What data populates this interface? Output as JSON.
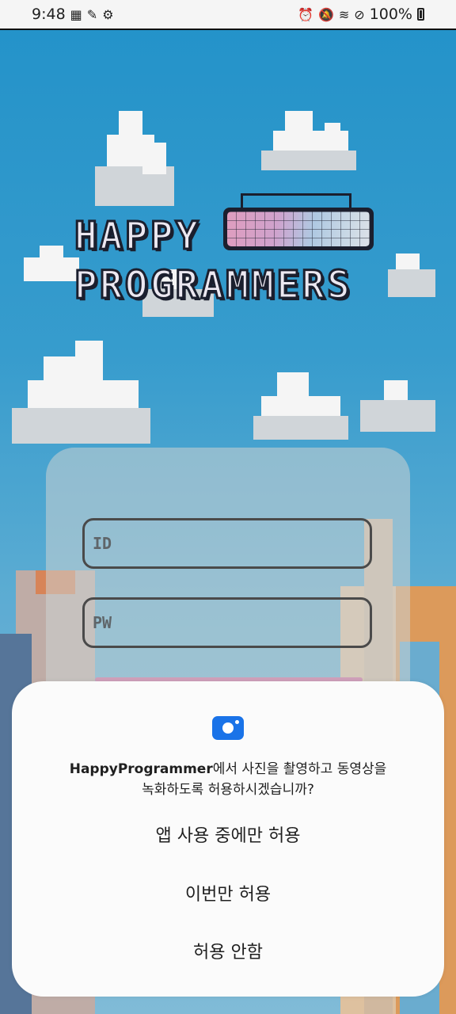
{
  "status_bar": {
    "time": "9:48",
    "left_icons": [
      "gallery-icon",
      "usb-debug-icon",
      "settings-icon"
    ],
    "right_icons": [
      "alarm-icon",
      "mute-icon",
      "wifi-icon",
      "block-icon"
    ],
    "battery": "100%"
  },
  "logo": {
    "line1": "HAPPY",
    "line2": "PROGRAMMERS"
  },
  "login": {
    "id_placeholder": "ID",
    "pw_placeholder": "PW"
  },
  "permission_dialog": {
    "icon": "camera-icon",
    "app_name": "HappyProgrammer",
    "message_line1_rest": "에서 사진을 촬영하고 동영상을",
    "message_line2": "녹화하도록 허용하시겠습니까?",
    "options": [
      "앱 사용 중에만 허용",
      "이번만 허용",
      "허용 안함"
    ],
    "accent_color": "#1a73e8"
  }
}
